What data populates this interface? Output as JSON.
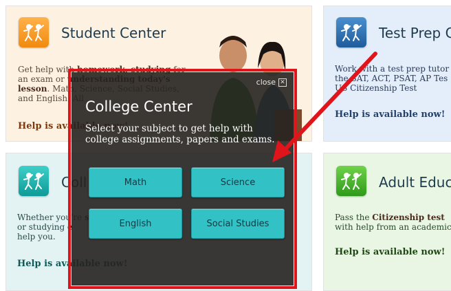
{
  "cards": {
    "student": {
      "title": "Student Center",
      "text_parts": [
        "Get help with ",
        "homework, studying",
        " for an exam or ",
        "understanding today's lesson",
        ". Math, Science, Social Studies, and English. All"
      ],
      "help": "Help is available now!"
    },
    "test_prep": {
      "title": "Test Prep C",
      "text": "Work with a test prep tutor the SAT, ACT, PSAT, AP Tes US Citizenship Test",
      "help": "Help is available now!"
    },
    "college": {
      "title": "Coll",
      "text_parts": [
        "Whether you're ",
        "",
        "s",
        " or studying ",
        "",
        "e",
        " help you."
      ],
      "help": "Help is available now!"
    },
    "adult": {
      "title": "Adult Educ",
      "text_parts": [
        "Pass the ",
        "Citizenship test",
        " with help from an academic"
      ],
      "help": "Help is available now!"
    }
  },
  "modal": {
    "close_label": "close",
    "close_glyph": "✕",
    "title": "College Center",
    "subtitle": "Select your subject to get help with college assignments, papers and exams.",
    "buttons": {
      "math": "Math",
      "science": "Science",
      "english": "English",
      "social": "Social Studies"
    }
  },
  "colors": {
    "highlight_red": "#e0141b",
    "button_teal": "#32c2c5",
    "modal_bg": "#262220"
  },
  "icons": [
    "people-logo-icon",
    "close-icon",
    "arrow-annotation"
  ]
}
